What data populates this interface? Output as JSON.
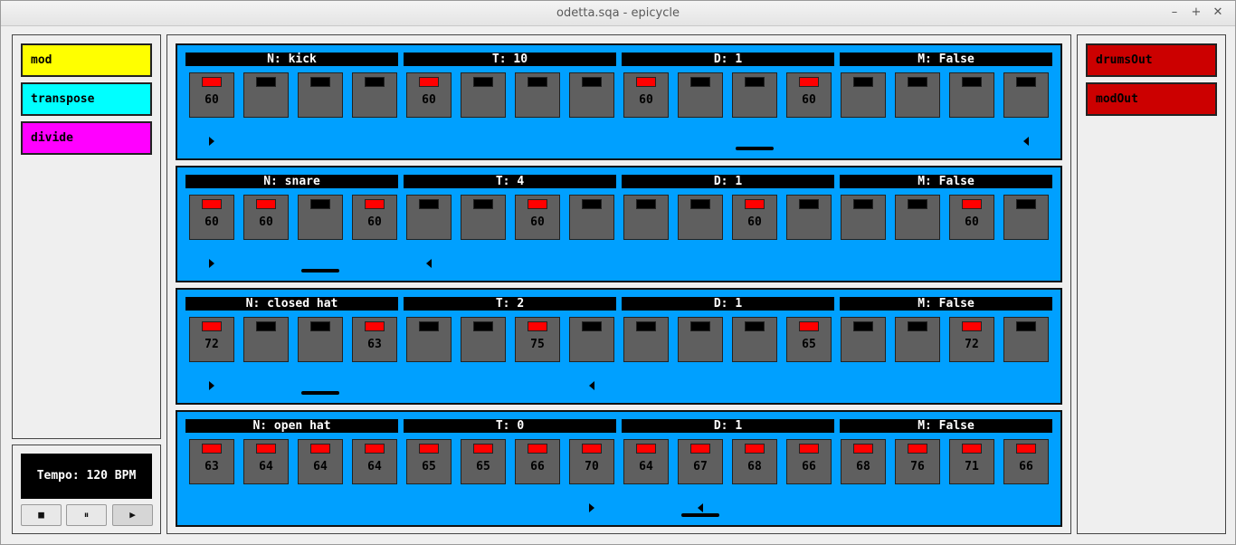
{
  "window": {
    "title": "odetta.sqa - epicycle",
    "minimize": "–",
    "maximize": "+",
    "close": "✕"
  },
  "modulators": [
    {
      "label": "mod",
      "color": "#ffff00"
    },
    {
      "label": "transpose",
      "color": "#00ffff"
    },
    {
      "label": "divide",
      "color": "#ff00ff"
    }
  ],
  "tempo": {
    "label": "Tempo: 120 BPM",
    "stop": "■",
    "pause": "⏸",
    "play": "▶"
  },
  "outputs": [
    {
      "label": "drumsOut",
      "color": "#cc0000"
    },
    {
      "label": "modOut",
      "color": "#cc0000"
    }
  ],
  "tracks": [
    {
      "headers": [
        "N: kick",
        "T: 10",
        "D: 1",
        "M: False"
      ],
      "steps": [
        {
          "on": true,
          "value": "60"
        },
        {
          "on": false,
          "value": ""
        },
        {
          "on": false,
          "value": ""
        },
        {
          "on": false,
          "value": ""
        },
        {
          "on": true,
          "value": "60"
        },
        {
          "on": false,
          "value": ""
        },
        {
          "on": false,
          "value": ""
        },
        {
          "on": false,
          "value": ""
        },
        {
          "on": true,
          "value": "60"
        },
        {
          "on": false,
          "value": ""
        },
        {
          "on": false,
          "value": ""
        },
        {
          "on": true,
          "value": "60"
        },
        {
          "on": false,
          "value": ""
        },
        {
          "on": false,
          "value": ""
        },
        {
          "on": false,
          "value": ""
        },
        {
          "on": false,
          "value": ""
        }
      ],
      "loop_start_step": 1,
      "loop_end_step": 16,
      "playhead_step": 11
    },
    {
      "headers": [
        "N: snare",
        "T: 4",
        "D: 1",
        "M: False"
      ],
      "steps": [
        {
          "on": true,
          "value": "60"
        },
        {
          "on": true,
          "value": "60"
        },
        {
          "on": false,
          "value": ""
        },
        {
          "on": true,
          "value": "60"
        },
        {
          "on": false,
          "value": ""
        },
        {
          "on": false,
          "value": ""
        },
        {
          "on": true,
          "value": "60"
        },
        {
          "on": false,
          "value": ""
        },
        {
          "on": false,
          "value": ""
        },
        {
          "on": false,
          "value": ""
        },
        {
          "on": true,
          "value": "60"
        },
        {
          "on": false,
          "value": ""
        },
        {
          "on": false,
          "value": ""
        },
        {
          "on": false,
          "value": ""
        },
        {
          "on": true,
          "value": "60"
        },
        {
          "on": false,
          "value": ""
        }
      ],
      "loop_start_step": 1,
      "loop_end_step": 5,
      "playhead_step": 3
    },
    {
      "headers": [
        "N: closed hat",
        "T: 2",
        "D: 1",
        "M: False"
      ],
      "steps": [
        {
          "on": true,
          "value": "72"
        },
        {
          "on": false,
          "value": ""
        },
        {
          "on": false,
          "value": ""
        },
        {
          "on": true,
          "value": "63"
        },
        {
          "on": false,
          "value": ""
        },
        {
          "on": false,
          "value": ""
        },
        {
          "on": true,
          "value": "75"
        },
        {
          "on": false,
          "value": ""
        },
        {
          "on": false,
          "value": ""
        },
        {
          "on": false,
          "value": ""
        },
        {
          "on": false,
          "value": ""
        },
        {
          "on": true,
          "value": "65"
        },
        {
          "on": false,
          "value": ""
        },
        {
          "on": false,
          "value": ""
        },
        {
          "on": true,
          "value": "72"
        },
        {
          "on": false,
          "value": ""
        }
      ],
      "loop_start_step": 1,
      "loop_end_step": 8,
      "playhead_step": 3
    },
    {
      "headers": [
        "N: open hat",
        "T: 0",
        "D: 1",
        "M: False"
      ],
      "steps": [
        {
          "on": true,
          "value": "63"
        },
        {
          "on": true,
          "value": "64"
        },
        {
          "on": true,
          "value": "64"
        },
        {
          "on": true,
          "value": "64"
        },
        {
          "on": true,
          "value": "65"
        },
        {
          "on": true,
          "value": "65"
        },
        {
          "on": true,
          "value": "66"
        },
        {
          "on": true,
          "value": "70"
        },
        {
          "on": true,
          "value": "64"
        },
        {
          "on": true,
          "value": "67"
        },
        {
          "on": true,
          "value": "68"
        },
        {
          "on": true,
          "value": "66"
        },
        {
          "on": true,
          "value": "68"
        },
        {
          "on": true,
          "value": "76"
        },
        {
          "on": true,
          "value": "71"
        },
        {
          "on": true,
          "value": "66"
        }
      ],
      "loop_start_step": 8,
      "loop_end_step": 10,
      "playhead_step": 10
    }
  ]
}
